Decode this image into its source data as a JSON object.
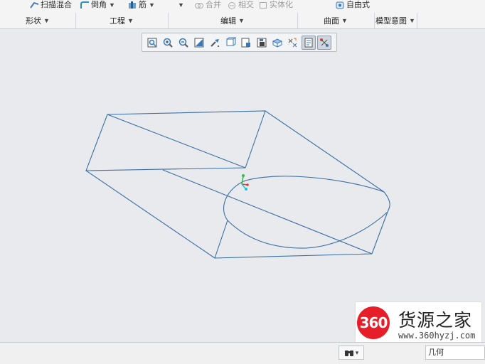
{
  "ribbon": {
    "row_buttons": {
      "sweep_blend": "扫描混合",
      "round": "倒角",
      "rib": "筋",
      "merge": "合并",
      "intersect": "相交",
      "solidify": "实体化",
      "freestyle": "自由式"
    },
    "groups": {
      "shape": "形状",
      "engineering": "工程",
      "editing": "编辑",
      "surfaces": "曲面",
      "model_intent": "模型意图"
    }
  },
  "view_toolbar": {
    "tools": [
      "refit-icon",
      "zoom-in-icon",
      "zoom-out-icon",
      "repaint-icon",
      "reorient-icon",
      "saved-views-icon",
      "display-style-icon",
      "section-icon",
      "view-manager-icon",
      "datum-display-icon",
      "annotation-display-icon",
      "spin-center-icon"
    ],
    "active": [
      "annotation-display-icon",
      "spin-center-icon"
    ]
  },
  "model": {
    "edge_color": "#3a6ea5",
    "triad_colors": {
      "x": "#e23b3b",
      "y": "#2fbf3f",
      "z": "#21c3d6"
    }
  },
  "watermark": {
    "logo_text": "360",
    "title": "货源之家",
    "url": "www.360hyzj.com"
  },
  "status": {
    "filter_value": "几何"
  }
}
